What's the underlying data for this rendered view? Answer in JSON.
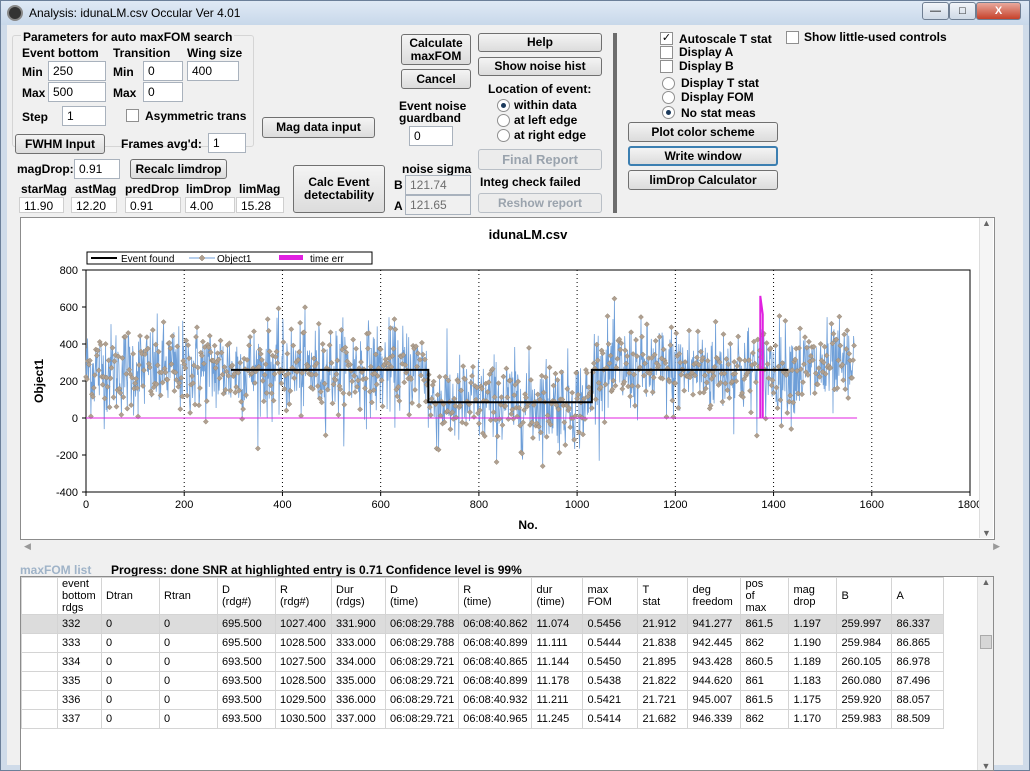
{
  "window": {
    "title": "Analysis: idunaLM.csv  Occular Ver 4.01",
    "min_symbol": "—",
    "max_symbol": "□",
    "close_symbol": "X"
  },
  "params": {
    "heading": "Parameters for auto maxFOM search",
    "event_bottom": "Event bottom",
    "transition": "Transition",
    "wing_size": "Wing size",
    "min": "Min",
    "max": "Max",
    "step": "Step",
    "eb_min": "250",
    "eb_max": "500",
    "tr_min": "0",
    "tr_max": "0",
    "wing": "400",
    "step_val": "1",
    "asym": "Asymmetric trans",
    "fwhm": "FWHM Input",
    "frames_label": "Frames avg'd:",
    "frames_val": "1",
    "magdrop_label": "magDrop:",
    "magdrop_val": "0.91",
    "recalc": "Recalc limdrop",
    "mag_data_input": "Mag data input",
    "calc_event": "Calc Event detectability"
  },
  "stats": {
    "headers": [
      "starMag",
      "astMag",
      "predDrop",
      "limDrop",
      "limMag"
    ],
    "values": [
      "11.90",
      "12.20",
      "0.91",
      "4.00",
      "15.28"
    ]
  },
  "middle": {
    "calc_maxfom": "Calculate maxFOM",
    "cancel": "Cancel",
    "event_noise": "Event noise guardband",
    "guardband_val": "0",
    "noise_sigma": "noise sigma",
    "b_label": "B",
    "a_label": "A",
    "b_val": "121.74",
    "a_val": "121.65",
    "help": "Help",
    "show_noise": "Show noise hist",
    "location": "Location of event:",
    "within": "within data",
    "left_edge": "at left edge",
    "right_edge": "at right edge",
    "final_report": "Final Report",
    "integ_failed": "Integ check failed",
    "reshow": "Reshow report"
  },
  "right": {
    "autoscale": "Autoscale T stat",
    "display_a": "Display A",
    "display_b": "Display B",
    "show_little": "Show little-used controls",
    "display_t": "Display T stat",
    "display_fom": "Display FOM",
    "no_stat": "No stat meas",
    "plot_color": "Plot color scheme",
    "write_window": "Write window",
    "limdrop_calc": "limDrop Calculator"
  },
  "chart_data": {
    "type": "line",
    "title": "idunaLM.csv",
    "xlabel": "No.",
    "ylabel": "Object1",
    "xlim": [
      0,
      1800
    ],
    "ylim": [
      -400,
      800
    ],
    "xticks": [
      0,
      200,
      400,
      600,
      800,
      1000,
      1200,
      1400,
      1600,
      1800
    ],
    "yticks": [
      -400,
      -200,
      0,
      200,
      400,
      600,
      800
    ],
    "grid": "vertical dotted",
    "legend": [
      "Event found",
      "Object1",
      "time err"
    ],
    "legend_placement": "top-left",
    "colors": {
      "event": "#000000",
      "object": "#6f9fd8",
      "marker": "#b0a090",
      "timeerr": "#e020e0"
    },
    "series": [
      {
        "name": "Event found",
        "x": [
          295,
          697,
          697,
          1030,
          1030,
          1430
        ],
        "y": [
          260,
          260,
          85,
          85,
          260,
          260
        ]
      },
      {
        "name": "Object1",
        "points": 1565,
        "mean_outside": 260,
        "mean_inside": 85,
        "noise_sigma": 122
      },
      {
        "name": "time err",
        "x": [
          1373,
          1373,
          1378,
          1378
        ],
        "y": [
          0,
          660,
          560,
          0
        ]
      }
    ]
  },
  "grid": {
    "tab_label": "maxFOM list",
    "progress": "Progress: done  SNR at highlighted entry is 0.71   Confidence level is 99%",
    "columns": [
      "event bottom rdgs",
      "Dtran",
      "Rtran",
      "D (rdg#)",
      "R (rdg#)",
      "Dur (rdgs)",
      "D (time)",
      "R (time)",
      "dur (time)",
      "max FOM",
      "T stat",
      "deg freedom",
      "pos of max",
      "mag drop",
      "B",
      "A"
    ],
    "rows": [
      [
        "332",
        "0",
        "0",
        "695.500",
        "1027.400",
        "331.900",
        "06:08:29.788",
        "06:08:40.862",
        "11.074",
        "0.5456",
        "21.912",
        "941.277",
        "861.5",
        "1.197",
        "259.997",
        "86.337"
      ],
      [
        "333",
        "0",
        "0",
        "695.500",
        "1028.500",
        "333.000",
        "06:08:29.788",
        "06:08:40.899",
        "11.111",
        "0.5444",
        "21.838",
        "942.445",
        "862",
        "1.190",
        "259.984",
        "86.865"
      ],
      [
        "334",
        "0",
        "0",
        "693.500",
        "1027.500",
        "334.000",
        "06:08:29.721",
        "06:08:40.865",
        "11.144",
        "0.5450",
        "21.895",
        "943.428",
        "860.5",
        "1.189",
        "260.105",
        "86.978"
      ],
      [
        "335",
        "0",
        "0",
        "693.500",
        "1028.500",
        "335.000",
        "06:08:29.721",
        "06:08:40.899",
        "11.178",
        "0.5438",
        "21.822",
        "944.620",
        "861",
        "1.183",
        "260.080",
        "87.496"
      ],
      [
        "336",
        "0",
        "0",
        "693.500",
        "1029.500",
        "336.000",
        "06:08:29.721",
        "06:08:40.932",
        "11.211",
        "0.5421",
        "21.721",
        "945.007",
        "861.5",
        "1.175",
        "259.920",
        "88.057"
      ],
      [
        "337",
        "0",
        "0",
        "693.500",
        "1030.500",
        "337.000",
        "06:08:29.721",
        "06:08:40.965",
        "11.245",
        "0.5414",
        "21.682",
        "946.339",
        "862",
        "1.170",
        "259.983",
        "88.509"
      ]
    ]
  }
}
